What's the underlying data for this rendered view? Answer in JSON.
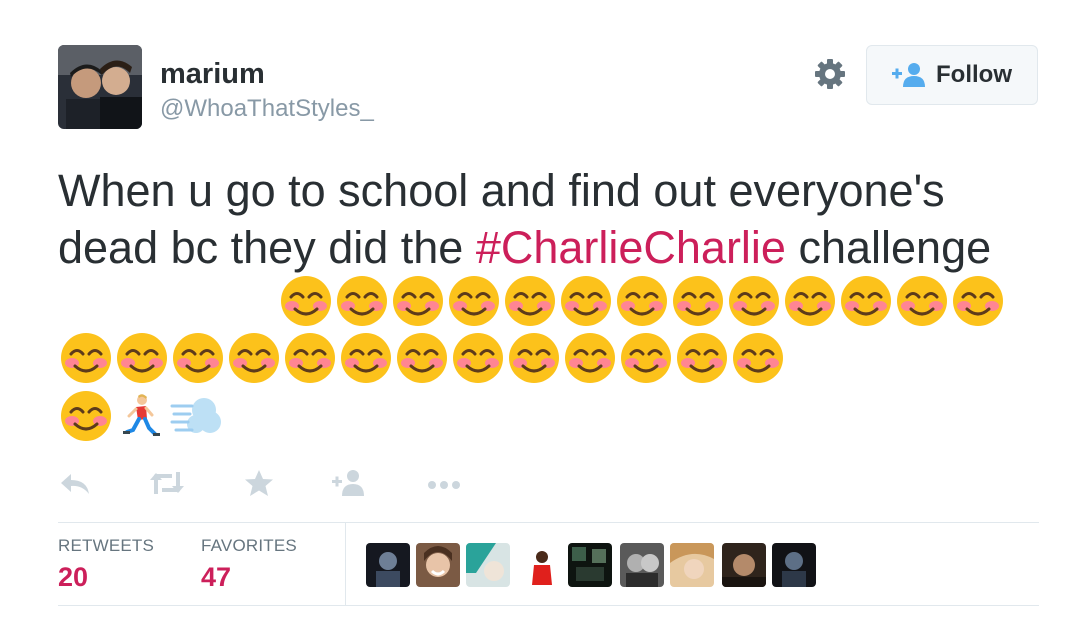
{
  "user": {
    "name": "marium",
    "handle": "@WhoaThatStyles_"
  },
  "follow_button": {
    "label": "Follow"
  },
  "tweet": {
    "text_before": "When u go to school and find out everyone's dead bc they did the ",
    "hashtag": "#CharlieCharlie",
    "text_after": " challenge",
    "emoji": {
      "smiling_face_count": 27,
      "trailing": [
        "runner",
        "dash"
      ]
    }
  },
  "stats": {
    "retweets_label": "RETWEETS",
    "retweets_count": "20",
    "favorites_label": "FAVORITES",
    "favorites_count": "47"
  },
  "colors": {
    "hashtag": "#cc1f5a",
    "count": "#cc1f5a",
    "text": "#292f33",
    "muted": "#8899a6",
    "follow_icon": "#55acee"
  },
  "icons": {
    "settings": "gear-icon",
    "follow": "follow-person-plus-icon",
    "reply": "reply-icon",
    "retweet": "retweet-icon",
    "favorite": "star-icon",
    "follow_action": "person-plus-icon",
    "more": "more-icon"
  }
}
